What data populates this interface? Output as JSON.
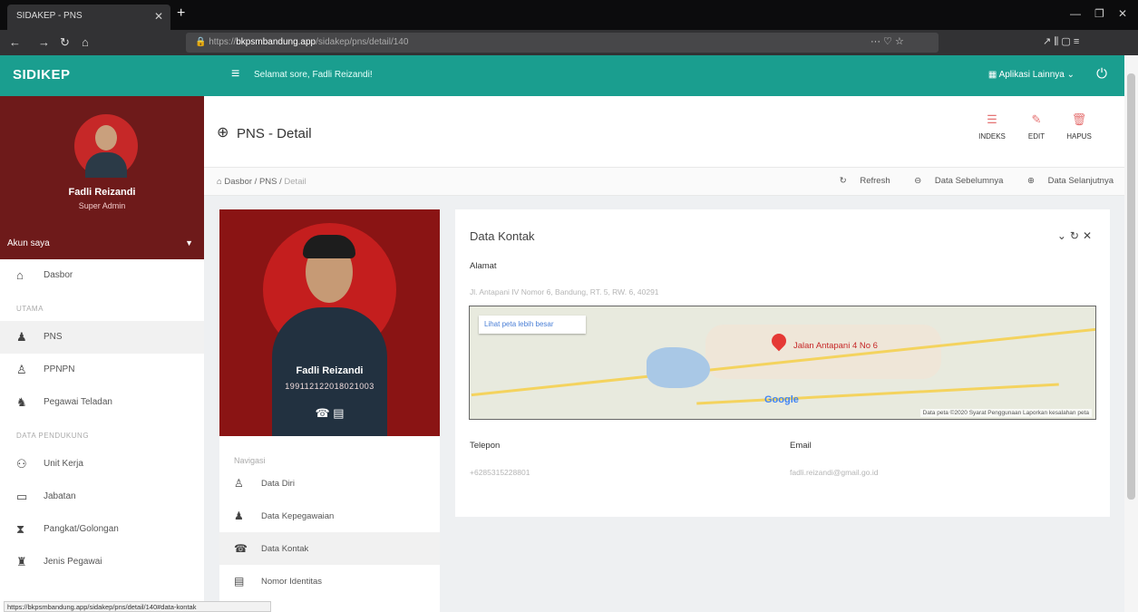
{
  "browser": {
    "tab_title": "SIDAKEP - PNS",
    "url_prefix": "https://",
    "url_domain": "bkpsmbandung.app",
    "url_path": "/sidakep/pns/detail/140"
  },
  "topbar": {
    "brand": "SIDIKEP",
    "greeting": "Selamat sore, Fadli Reizandi!",
    "apps_label": "Aplikasi Lainnya"
  },
  "sidebar": {
    "profile_name": "Fadli Reizandi",
    "profile_role": "Super Admin",
    "account_label": "Akun saya",
    "items": [
      {
        "label": "Dasbor",
        "icon": "home-icon"
      },
      {
        "header": "UTAMA"
      },
      {
        "label": "PNS",
        "icon": "user-tie-icon",
        "active": true
      },
      {
        "label": "PPNPN",
        "icon": "user-icon"
      },
      {
        "label": "Pegawai Teladan",
        "icon": "user-star-icon"
      },
      {
        "header": "DATA PENDUKUNG"
      },
      {
        "label": "Unit Kerja",
        "icon": "sitemap-icon"
      },
      {
        "label": "Jabatan",
        "icon": "briefcase-icon"
      },
      {
        "label": "Pangkat/Golongan",
        "icon": "rank-icon"
      },
      {
        "label": "Jenis Pegawai",
        "icon": "users-icon"
      }
    ]
  },
  "page": {
    "title": "PNS - Detail",
    "actions": [
      {
        "label": "INDEKS"
      },
      {
        "label": "EDIT"
      },
      {
        "label": "HAPUS"
      }
    ],
    "breadcrumb": [
      "Dasbor",
      "PNS",
      "Detail"
    ],
    "crumb_right": [
      "Refresh",
      "Data Sebelumnya",
      "Data Selanjutnya"
    ]
  },
  "employee": {
    "name": "Fadli Reizandi",
    "nip": "199112122018021003",
    "nav_header": "Navigasi",
    "nav": [
      {
        "label": "Data Diri",
        "icon": "user-icon"
      },
      {
        "label": "Data Kepegawaian",
        "icon": "user-tie-icon"
      },
      {
        "label": "Data Kontak",
        "icon": "phone-icon",
        "active": true
      },
      {
        "label": "Nomor Identitas",
        "icon": "id-card-icon"
      }
    ]
  },
  "kontak": {
    "title": "Data Kontak",
    "alamat_label": "Alamat",
    "alamat_value": "Jl. Antapani IV Nomor 6, Bandung, RT. 5, RW. 6, 40291",
    "map_larger": "Lihat peta lebih besar",
    "map_pin_label": "Jalan Antapani 4 No 6",
    "map_footer": "Data peta ©2020   Syarat Penggunaan   Laporkan kesalahan peta",
    "telepon_label": "Telepon",
    "telepon_value": "+6285315228801",
    "email_label": "Email",
    "email_value": "fadli.reizandi@gmail.go.id"
  },
  "statusbar": "https://bkpsmbandung.app/sidakep/pns/detail/140#data-kontak",
  "colors": {
    "accent": "#1a9e8f",
    "danger": "#e57373",
    "profile_bg": "#8a1414"
  }
}
